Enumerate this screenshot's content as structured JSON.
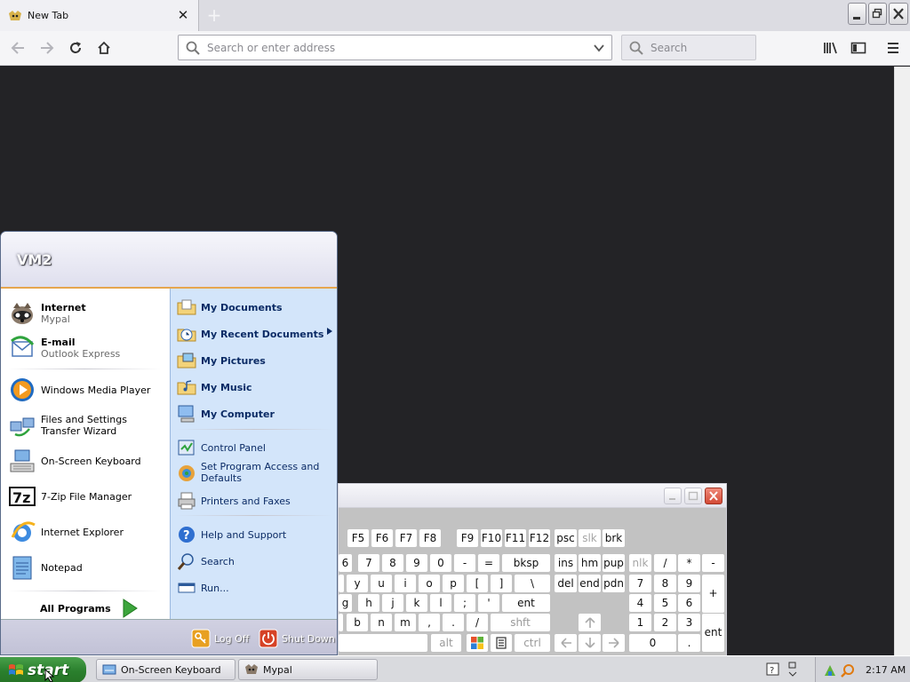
{
  "browser": {
    "tab_title": "New Tab",
    "urlbar_placeholder": "Search or enter address",
    "search_placeholder": "Search"
  },
  "start_menu": {
    "user_name": "VM2",
    "pinned": [
      {
        "title": "Internet",
        "subtitle": "Mypal"
      },
      {
        "title": "E-mail",
        "subtitle": "Outlook Express"
      }
    ],
    "recent": [
      "Windows Media Player",
      "Files and Settings Transfer Wizard",
      "On-Screen Keyboard",
      "7-Zip File Manager",
      "Internet Explorer",
      "Notepad"
    ],
    "all_programs": "All Programs",
    "places": [
      "My Documents",
      "My Recent Documents",
      "My Pictures",
      "My Music",
      "My Computer"
    ],
    "system": [
      "Control Panel",
      "Set Program Access and Defaults",
      "Printers and Faxes"
    ],
    "help": [
      "Help and Support",
      "Search",
      "Run..."
    ],
    "log_off": "Log Off",
    "shut_down": "Shut Down"
  },
  "keyboard": {
    "fn_row": [
      "F5",
      "F6",
      "F7",
      "F8",
      "F9",
      "F10",
      "F11",
      "F12",
      "psc",
      "slk",
      "brk"
    ],
    "row2": [
      "6",
      "7",
      "8",
      "9",
      "0",
      "-",
      "=",
      "bksp",
      "ins",
      "hm",
      "pup",
      "nlk",
      "/",
      "*",
      "-"
    ],
    "row3": [
      "y",
      "u",
      "i",
      "o",
      "p",
      "[",
      "]",
      "\\",
      "del",
      "end",
      "pdn",
      "7",
      "8",
      "9",
      "+"
    ],
    "row4": [
      "g",
      "h",
      "j",
      "k",
      "l",
      ";",
      "'",
      "ent",
      "4",
      "5",
      "6"
    ],
    "row5": [
      "b",
      "n",
      "m",
      ",",
      ".",
      "/",
      "shft",
      "1",
      "2",
      "3",
      "ent"
    ],
    "row6": [
      "alt",
      "ctrl",
      "0",
      "."
    ]
  },
  "taskbar": {
    "start_label": "start",
    "tasks": [
      "On-Screen Keyboard",
      "Mypal"
    ],
    "clock": "2:17 AM"
  }
}
